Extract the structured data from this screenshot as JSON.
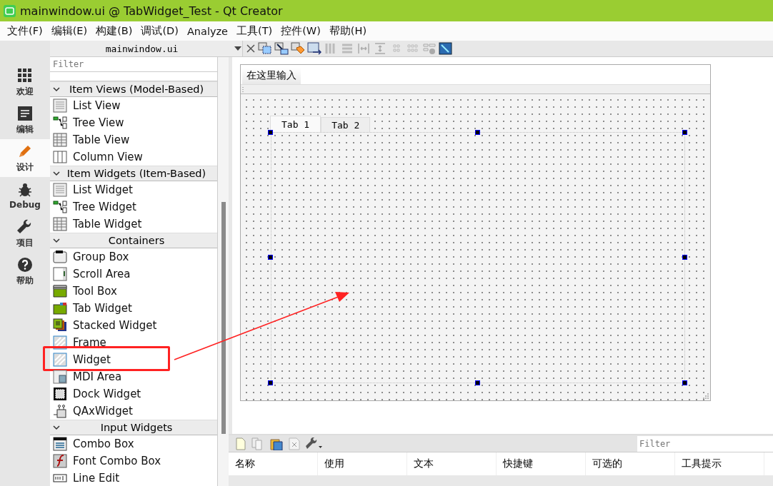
{
  "window": {
    "title": "mainwindow.ui @ TabWidget_Test - Qt Creator"
  },
  "menu": [
    "文件(F)",
    "编辑(E)",
    "构建(B)",
    "调试(D)",
    "Analyze",
    "工具(T)",
    "控件(W)",
    "帮助(H)"
  ],
  "mode_bar": [
    {
      "label": "欢迎",
      "kind": "welcome",
      "selected": false
    },
    {
      "label": "编辑",
      "kind": "edit",
      "selected": false
    },
    {
      "label": "设计",
      "kind": "design",
      "selected": true
    },
    {
      "label": "Debug",
      "kind": "debug",
      "selected": false
    },
    {
      "label": "项目",
      "kind": "projects",
      "selected": false
    },
    {
      "label": "帮助",
      "kind": "help",
      "selected": false
    }
  ],
  "editor_toolbar": {
    "file": "mainwindow.ui"
  },
  "widget_box": {
    "filter_placeholder": "Filter",
    "groups": [
      {
        "title": "Item Views (Model-Based)",
        "expanded": true,
        "items": [
          {
            "label": "List View",
            "kind": "list",
            "highlighted": false
          },
          {
            "label": "Tree View",
            "kind": "tree",
            "highlighted": false
          },
          {
            "label": "Table View",
            "kind": "table",
            "highlighted": false
          },
          {
            "label": "Column View",
            "kind": "columns",
            "highlighted": false
          }
        ]
      },
      {
        "title": "Item Widgets (Item-Based)",
        "expanded": true,
        "items": [
          {
            "label": "List Widget",
            "kind": "list",
            "highlighted": false
          },
          {
            "label": "Tree Widget",
            "kind": "tree",
            "highlighted": false
          },
          {
            "label": "Table Widget",
            "kind": "table",
            "highlighted": false
          }
        ]
      },
      {
        "title": "Containers",
        "expanded": true,
        "items": [
          {
            "label": "Group Box",
            "kind": "group",
            "highlighted": false
          },
          {
            "label": "Scroll Area",
            "kind": "scroll",
            "highlighted": false
          },
          {
            "label": "Tool Box",
            "kind": "toolbox",
            "highlighted": false
          },
          {
            "label": "Tab Widget",
            "kind": "tab",
            "highlighted": false
          },
          {
            "label": "Stacked Widget",
            "kind": "stacked",
            "highlighted": false
          },
          {
            "label": "Frame",
            "kind": "frame",
            "highlighted": false
          },
          {
            "label": "Widget",
            "kind": "widget",
            "highlighted": true
          },
          {
            "label": "MDI Area",
            "kind": "mdi",
            "highlighted": false
          },
          {
            "label": "Dock Widget",
            "kind": "dock",
            "highlighted": false
          },
          {
            "label": "QAxWidget",
            "kind": "activex",
            "highlighted": false
          }
        ]
      },
      {
        "title": "Input Widgets",
        "expanded": true,
        "items": [
          {
            "label": "Combo Box",
            "kind": "combo",
            "highlighted": false
          },
          {
            "label": "Font Combo Box",
            "kind": "font",
            "highlighted": false
          },
          {
            "label": "Line Edit",
            "kind": "lineedit",
            "highlighted": false
          }
        ]
      }
    ]
  },
  "form": {
    "menu_placeholder": "在这里输入",
    "tabs": [
      {
        "label": "Tab 1",
        "selected": true
      },
      {
        "label": "Tab 2",
        "selected": false
      }
    ]
  },
  "action_editor": {
    "filter_placeholder": "Filter",
    "columns": [
      "名称",
      "使用",
      "文本",
      "快捷键",
      "可选的",
      "工具提示"
    ]
  }
}
